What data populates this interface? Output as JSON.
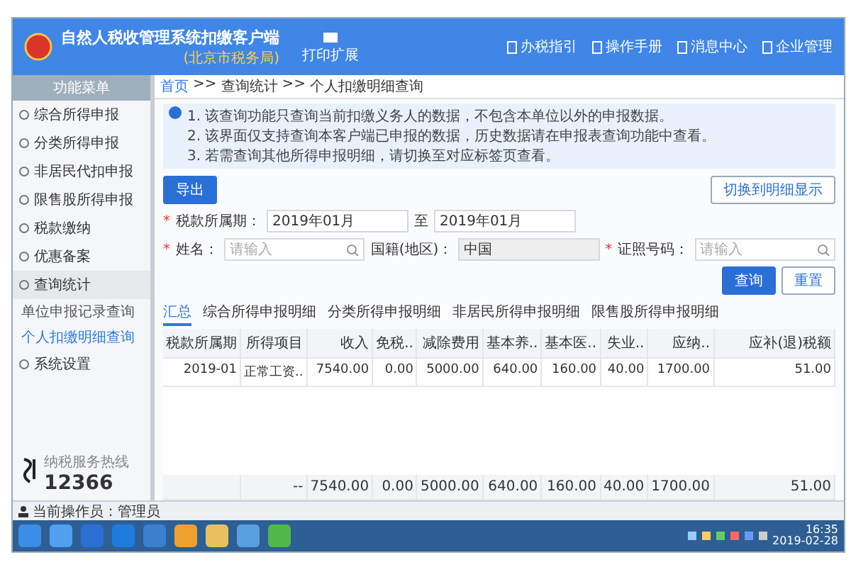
{
  "window": {
    "title": "自然人税收管理系统扣缴客户端",
    "subtitle": "(北京市税务局)",
    "badge_label": "打印扩展"
  },
  "header_links": [
    "办税指引",
    "操作手册",
    "消息中心",
    "企业管理"
  ],
  "sidebar": {
    "title": "功能菜单",
    "items": [
      {
        "label": "综合所得申报",
        "expanded": false
      },
      {
        "label": "分类所得申报",
        "expanded": false
      },
      {
        "label": "非居民代扣申报",
        "expanded": false
      },
      {
        "label": "限售股所得申报",
        "expanded": false
      },
      {
        "label": "税款缴纳",
        "expanded": false
      },
      {
        "label": "优惠备案",
        "expanded": false
      },
      {
        "label": "查询统计",
        "expanded": true,
        "children": [
          {
            "label": "单位申报记录查询",
            "selected": false
          },
          {
            "label": "个人扣缴明细查询",
            "selected": true
          }
        ]
      },
      {
        "label": "系统设置",
        "expanded": false
      }
    ],
    "hotline_caption": "纳税服务热线",
    "hotline": "12366"
  },
  "breadcrumb": [
    "首页",
    ">>",
    "查询统计",
    ">>",
    "个人扣缴明细查询"
  ],
  "notice": [
    "1. 该查询功能只查询当前扣缴义务人的数据，不包含本单位以外的申报数据。",
    "2. 该界面仅支持查询本客户端已申报的数据，历史数据请在申报表查询功能中查看。",
    "3. 若需查询其他所得申报明细，请切换至对应标签页查看。"
  ],
  "export_button": "导出",
  "switch_button": "切换到明细显示",
  "form": {
    "required_mark": "*",
    "period_label": "税款所属期：",
    "period_from": "2019年01月",
    "period_to_label": "至",
    "period_to": "2019年01月",
    "name_label": "姓名：",
    "name_placeholder": "请输入",
    "region_label": "国籍(地区)：",
    "region_value": "中国",
    "id_label": "证照号码：",
    "id_placeholder": "请输入",
    "query_button": "查询",
    "reset_button": "重置"
  },
  "tabs": [
    {
      "label": "汇总",
      "selected": true
    },
    {
      "label": "综合所得申报明细",
      "selected": false
    },
    {
      "label": "分类所得申报明细",
      "selected": false
    },
    {
      "label": "非居民所得申报明细",
      "selected": false
    },
    {
      "label": "限售股所得申报明细",
      "selected": false
    }
  ],
  "table": {
    "columns": [
      "税款所属期",
      "所得项目",
      "收入",
      "免税..",
      "减除费用",
      "基本养..",
      "基本医..",
      "失业..",
      "应纳..",
      "应补(退)税额"
    ],
    "rows": [
      [
        "2019-01",
        "正常工资..",
        "7540.00",
        "0.00",
        "5000.00",
        "640.00",
        "160.00",
        "40.00",
        "1700.00",
        "51.00"
      ]
    ],
    "total": [
      "--",
      "7540.00",
      "0.00",
      "5000.00",
      "640.00",
      "160.00",
      "40.00",
      "1700.00",
      "51.00"
    ]
  },
  "status_bar": {
    "operator": "当前操作员：管理员"
  },
  "taskbar": {
    "time": "16:35",
    "date": "2019-02-28"
  }
}
